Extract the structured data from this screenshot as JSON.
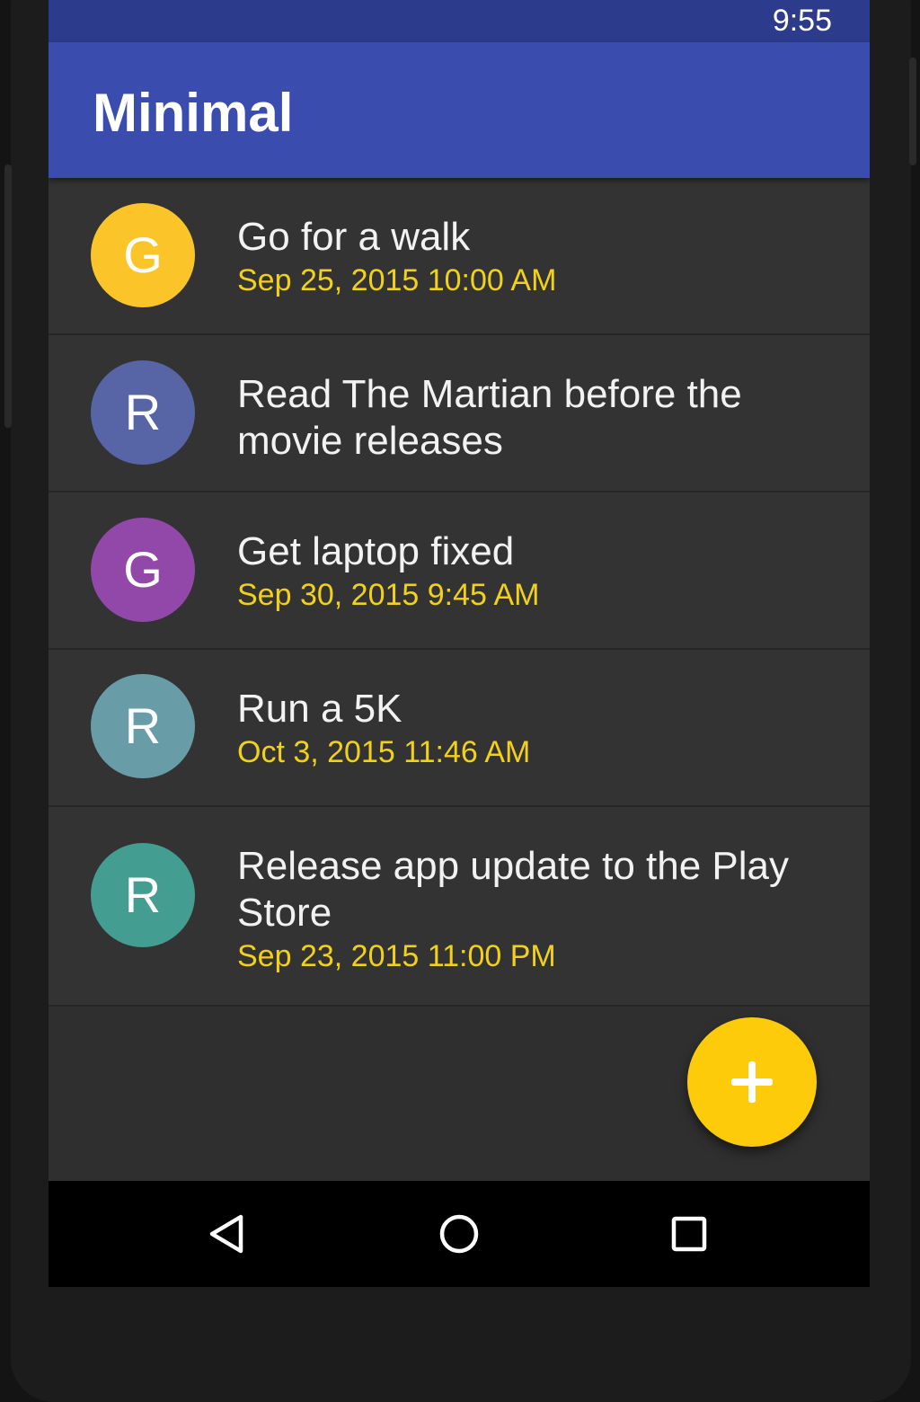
{
  "status_bar": {
    "time": "9:55"
  },
  "app_bar": {
    "title": "Minimal"
  },
  "items": [
    {
      "letter": "G",
      "title": "Go for a walk",
      "date": "Sep 25, 2015 10:00 AM",
      "color": "#fbc52a"
    },
    {
      "letter": "R",
      "title": "Read The Martian before the movie releases",
      "date": "",
      "color": "#5764a6"
    },
    {
      "letter": "G",
      "title": "Get laptop fixed",
      "date": "Sep 30, 2015 9:45 AM",
      "color": "#9148a9"
    },
    {
      "letter": "R",
      "title": "Run a 5K",
      "date": "Oct 3, 2015 11:46 AM",
      "color": "#689da7"
    },
    {
      "letter": "R",
      "title": "Release app update to the Play Store",
      "date": "Sep 23, 2015 11:00 PM",
      "color": "#439d90"
    }
  ],
  "fab": {
    "icon": "plus-icon",
    "color": "#fecb0a"
  },
  "nav_bar": {
    "back_icon": "back-triangle-icon",
    "home_icon": "home-circle-icon",
    "recents_icon": "recents-square-icon"
  },
  "colors": {
    "status_bar": "#2d3b8c",
    "app_bar": "#3a4dae",
    "list_bg": "#333333",
    "date_text": "#f2d11a"
  }
}
